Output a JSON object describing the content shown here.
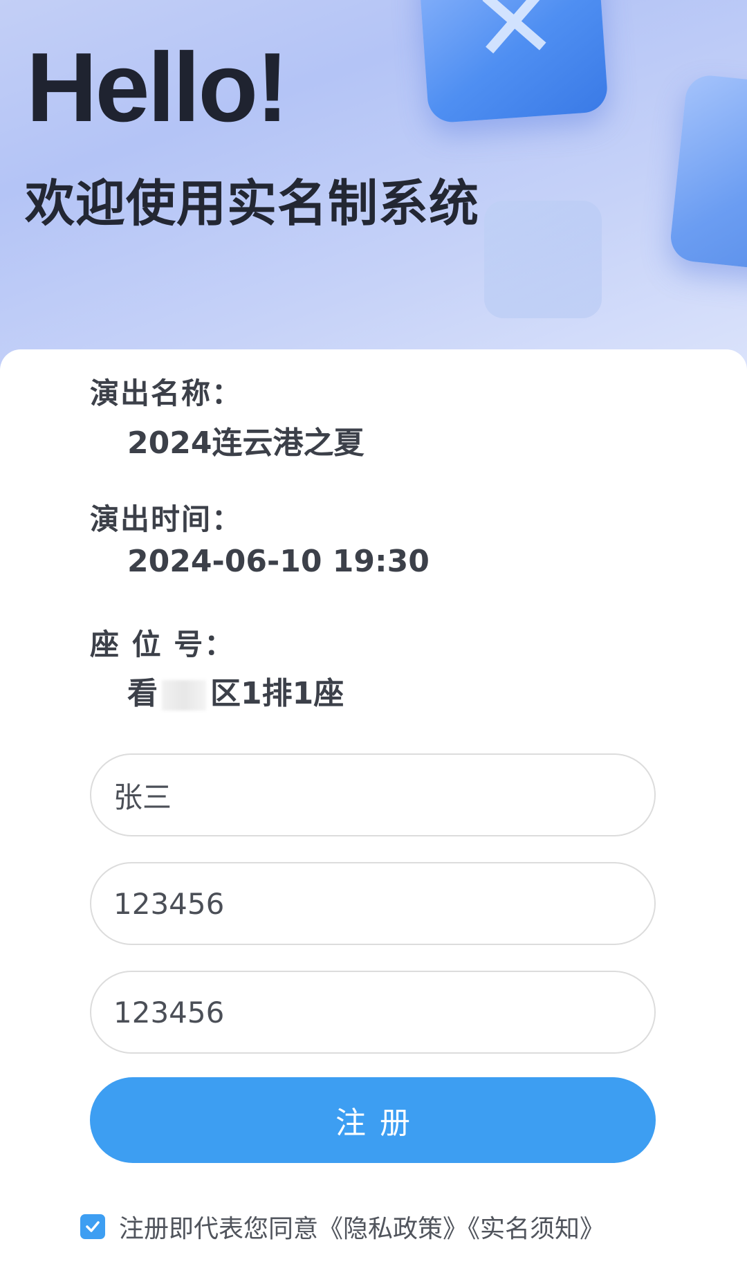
{
  "header": {
    "greeting": "Hello!",
    "subtitle": "欢迎使用实名制系统"
  },
  "info": {
    "show_name_label": "演出名称：",
    "show_name_value": "2024连云港之夏",
    "show_time_label": "演出时间：",
    "show_time_value": "2024-06-10 19:30",
    "seat_label": "座 位 号：",
    "seat_value_prefix": "看",
    "seat_value_suffix": "区1排1座"
  },
  "form": {
    "name_value": "张三",
    "field2_value": "123456",
    "field3_value": "123456",
    "register_label": "注册"
  },
  "agreement": {
    "checked": true,
    "text": "注册即代表您同意《隐私政策》《实名须知》"
  },
  "colors": {
    "accent": "#3d9ef2",
    "header_gradient_start": "#c3cff6",
    "text_dark": "#1f2330"
  },
  "icons": {
    "checkbox": "check-icon"
  }
}
